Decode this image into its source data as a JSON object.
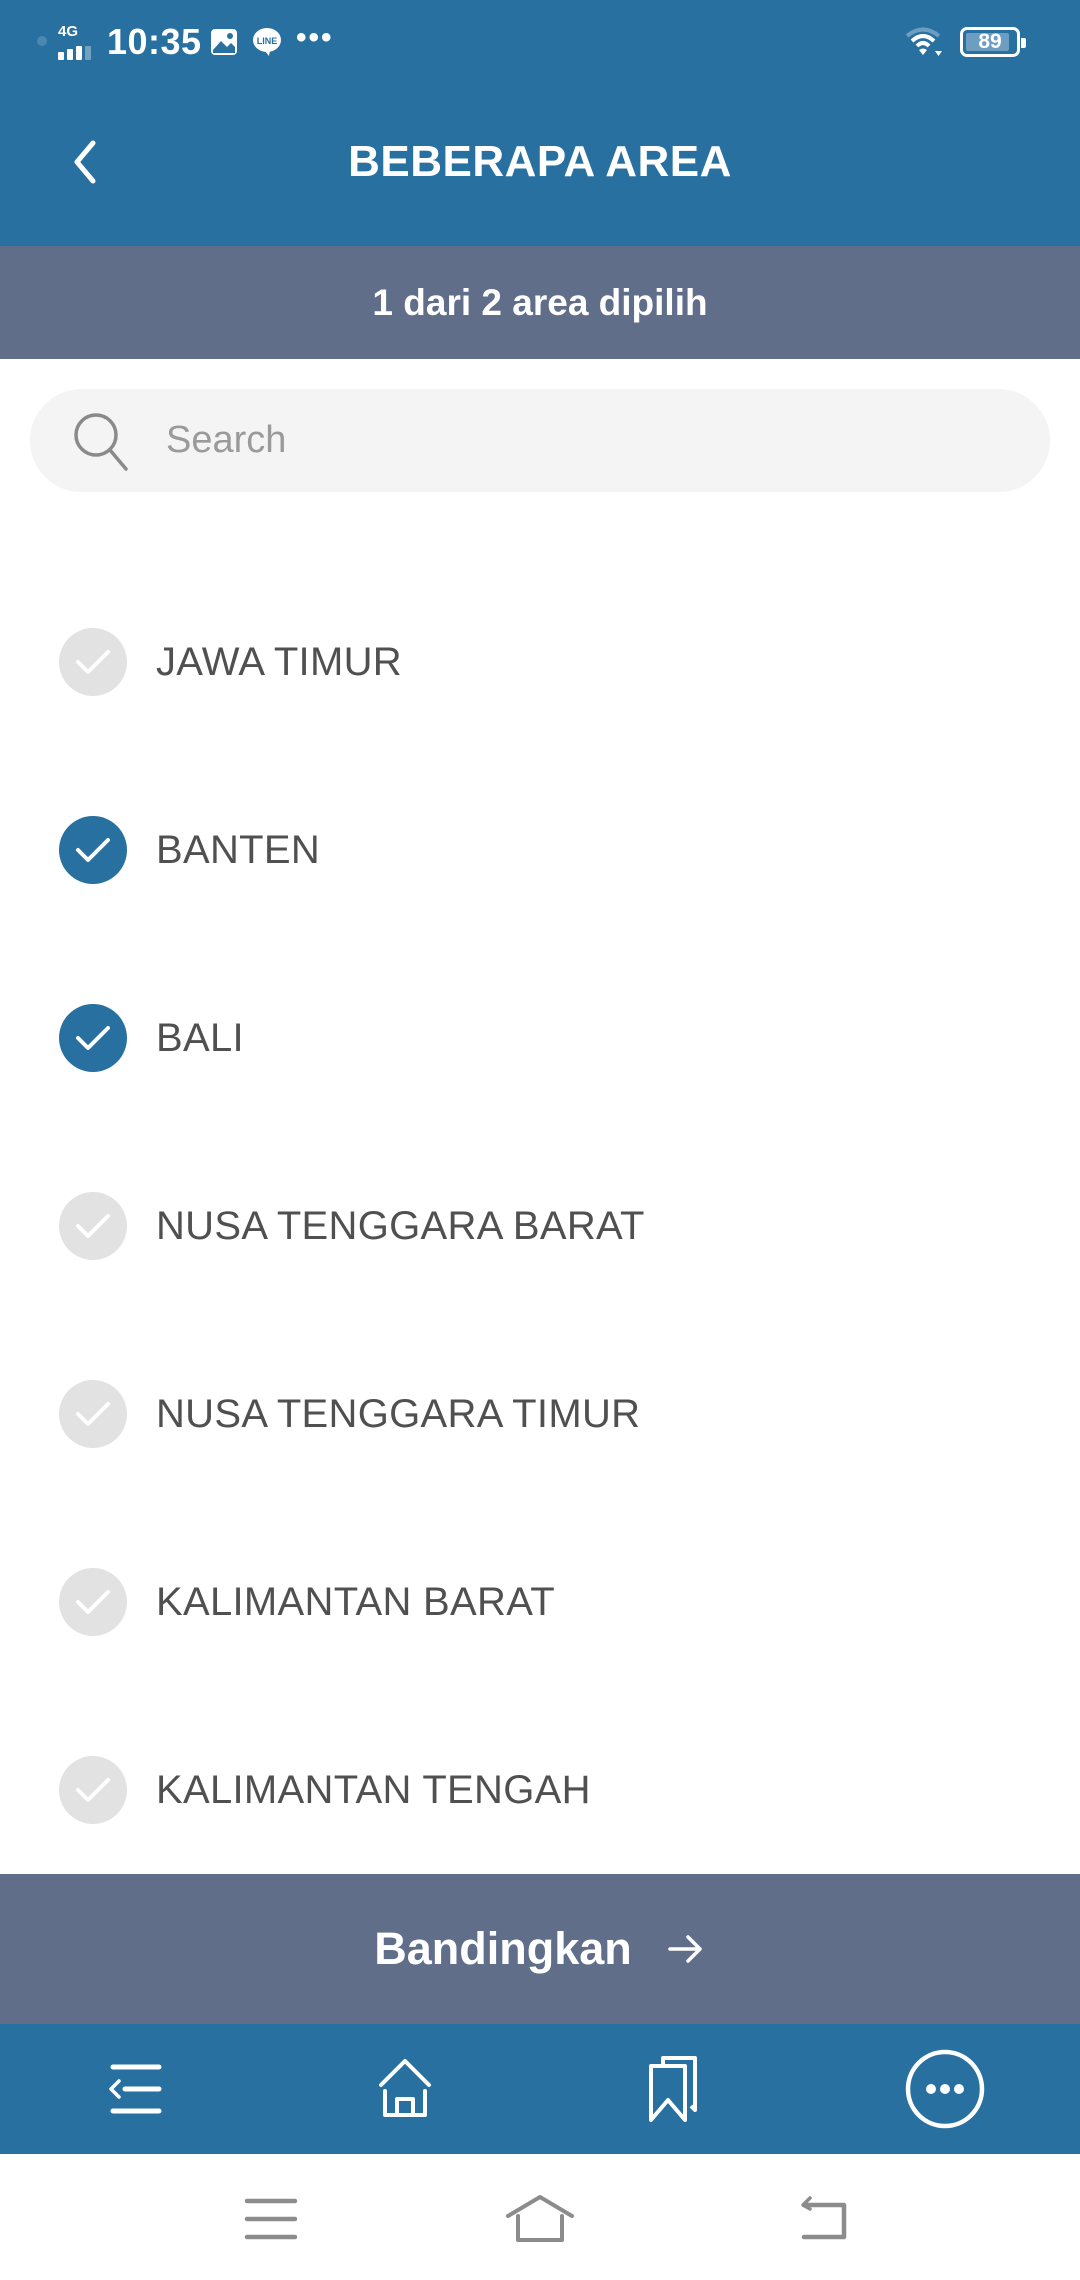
{
  "status_bar": {
    "network": "4G",
    "time": "10:35",
    "notification_icons": [
      "image-icon",
      "line-app-icon",
      "more-notifications-icon"
    ],
    "more": "•••",
    "battery": "89",
    "battery_level": 0.89
  },
  "header": {
    "title": "BEBERAPA AREA",
    "back_icon": "chevron-left-icon"
  },
  "selection_summary": "1 dari 2 area dipilih",
  "search": {
    "placeholder": "Search",
    "value": ""
  },
  "areas": [
    {
      "label": "JAWA TIMUR",
      "checked": false
    },
    {
      "label": "BANTEN",
      "checked": true
    },
    {
      "label": "BALI",
      "checked": true
    },
    {
      "label": "NUSA TENGGARA BARAT",
      "checked": false
    },
    {
      "label": "NUSA TENGGARA TIMUR",
      "checked": false
    },
    {
      "label": "KALIMANTAN BARAT",
      "checked": false
    },
    {
      "label": "KALIMANTAN TENGAH",
      "checked": false
    }
  ],
  "compare_button": {
    "label": "Bandingkan",
    "icon": "arrow-right-icon"
  },
  "bottom_nav": {
    "items": [
      "menu-list-icon",
      "home-icon",
      "bookmarks-icon",
      "more-options-icon"
    ]
  },
  "system_nav": {
    "items": [
      "recent-apps-icon",
      "home-icon",
      "back-icon"
    ]
  },
  "colors": {
    "primary": "#27709f",
    "secondary": "#606e8a",
    "unchecked": "#e2e2e2",
    "text": "#505050"
  }
}
